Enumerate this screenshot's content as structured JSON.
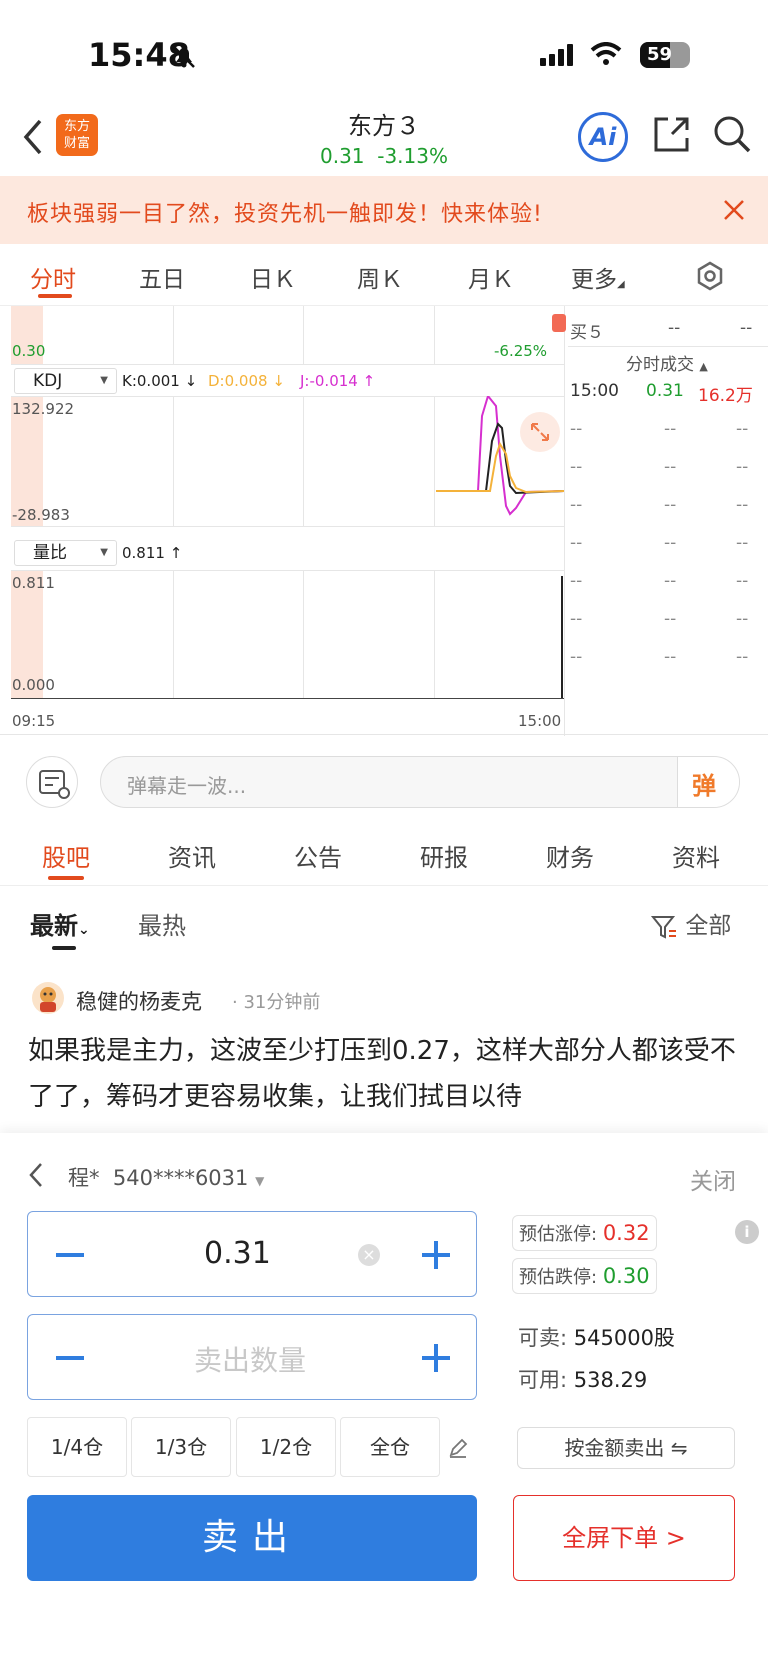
{
  "status_bar": {
    "time": "15:48",
    "battery": "59"
  },
  "header": {
    "title": "东方３",
    "price": "0.31",
    "change_pct": "-3.13%",
    "logo_top": "东方",
    "logo_bottom": "财富",
    "ai_label": "Ai"
  },
  "banner": {
    "text": "板块强弱一目了然，投资先机一触即发！快来体验!"
  },
  "tabs": [
    "分时",
    "五日",
    "日Ｋ",
    "周Ｋ",
    "月Ｋ",
    "更多"
  ],
  "chart": {
    "price_low_label": "0.30",
    "price_low_pct": "-6.25%",
    "kdj_selector": "KDJ",
    "kdj_k": "K:0.001 ↓",
    "kdj_d": "D:0.008 ↓",
    "kdj_j": "J:-0.014 ↑",
    "kdj_max": "132.922",
    "kdj_min": "-28.983",
    "vol_selector": "量比",
    "vol_value": "0.811 ↑",
    "vol_max": "0.811",
    "vol_min": "0.000",
    "time_start": "09:15",
    "time_end": "15:00"
  },
  "order_book": {
    "buy5_label": "买５",
    "buy5_price": "--",
    "buy5_vol": "--",
    "trades_title": "分时成交",
    "trades": [
      {
        "time": "15:00",
        "price": "0.31",
        "vol": "16.2万"
      },
      {
        "time": "--",
        "price": "--",
        "vol": "--"
      },
      {
        "time": "--",
        "price": "--",
        "vol": "--"
      },
      {
        "time": "--",
        "price": "--",
        "vol": "--"
      },
      {
        "time": "--",
        "price": "--",
        "vol": "--"
      },
      {
        "time": "--",
        "price": "--",
        "vol": "--"
      },
      {
        "time": "--",
        "price": "--",
        "vol": "--"
      },
      {
        "time": "--",
        "price": "--",
        "vol": "--"
      }
    ]
  },
  "chat": {
    "placeholder": "弹幕走一波...",
    "send_label": "弹"
  },
  "sub_tabs": [
    "股吧",
    "资讯",
    "公告",
    "研报",
    "财务",
    "资料"
  ],
  "sort_tabs": {
    "latest": "最新",
    "hot": "最热",
    "filter": "全部"
  },
  "post": {
    "author": "稳健的杨麦克",
    "time": "· 31分钟前",
    "content": "如果我是主力，这波至少打压到0.27，这样大部分人都该受不了了，筹码才更容易收集，让我们拭目以待"
  },
  "trade_panel": {
    "account_name": "程*",
    "account_no": "540****6031",
    "close_label": "关闭",
    "price_value": "0.31",
    "qty_placeholder": "卖出数量",
    "limit_up_label": "预估涨停:",
    "limit_up_value": "0.32",
    "limit_down_label": "预估跌停:",
    "limit_down_value": "0.30",
    "sellable_label": "可卖:",
    "sellable_value": "545000股",
    "available_label": "可用:",
    "available_value": "538.29",
    "positions": [
      "1/4仓",
      "1/3仓",
      "1/2仓",
      "全仓"
    ],
    "by_amount_label": "按金额卖出 ⇋",
    "sell_label": "卖出",
    "fullscreen_label": "全屏下单 >"
  }
}
